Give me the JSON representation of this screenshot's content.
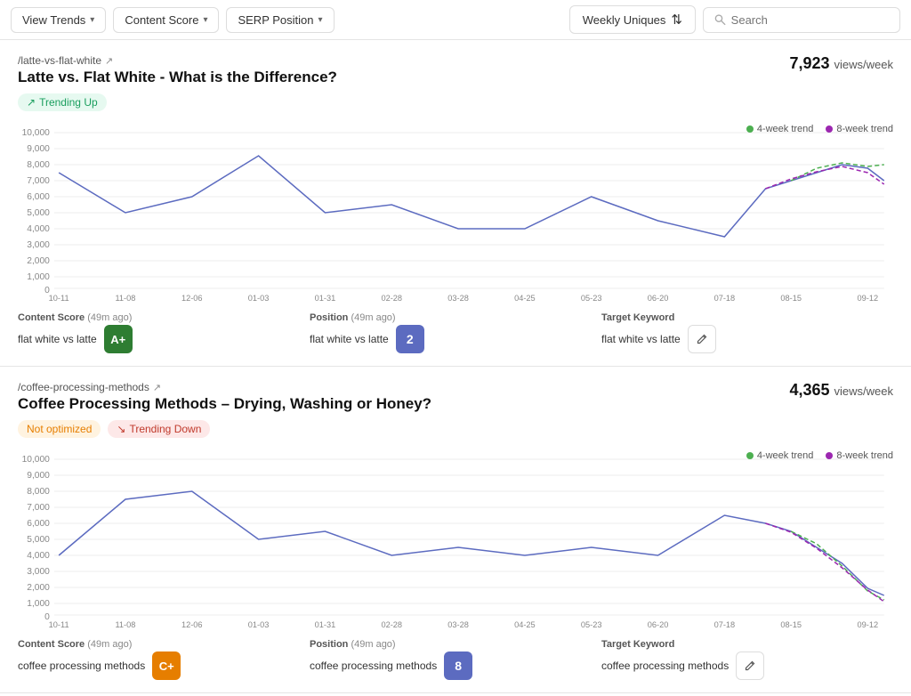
{
  "toolbar": {
    "view_trends_label": "View Trends",
    "content_score_label": "Content Score",
    "serp_position_label": "SERP Position",
    "weekly_uniques_label": "Weekly Uniques",
    "search_placeholder": "Search"
  },
  "cards": [
    {
      "url": "/latte-vs-flat-white",
      "title": "Latte vs. Flat White - What is the Difference?",
      "views": "7,923",
      "views_label": "views/week",
      "badge": "trending_up",
      "badge_label": "Trending Up",
      "legend_4week": "4-week trend",
      "legend_8week": "8-week trend",
      "chart_y_labels": [
        "10,000",
        "9,000",
        "8,000",
        "7,000",
        "6,000",
        "5,000",
        "4,000",
        "3,000",
        "2,000",
        "1,000",
        "0"
      ],
      "chart_x_labels": [
        "10-11",
        "11-08",
        "12-06",
        "01-03",
        "01-31",
        "02-28",
        "03-28",
        "04-25",
        "05-23",
        "06-20",
        "07-18",
        "08-15",
        "09-12"
      ],
      "footer": {
        "content_score_label": "Content Score",
        "content_score_time": "(49m ago)",
        "content_score_keyword": "flat white vs latte",
        "content_score_value": "A+",
        "position_label": "Position",
        "position_time": "(49m ago)",
        "position_keyword": "flat white vs latte",
        "position_value": "2",
        "target_keyword_label": "Target Keyword",
        "target_keyword_value": "flat white vs latte"
      }
    },
    {
      "url": "/coffee-processing-methods",
      "title": "Coffee Processing Methods – Drying, Washing or Honey?",
      "views": "4,365",
      "views_label": "views/week",
      "badge": "not_optimized_and_trending_down",
      "badge_not_optimized_label": "Not optimized",
      "badge_trending_down_label": "Trending Down",
      "legend_4week": "4-week trend",
      "legend_8week": "8-week trend",
      "chart_y_labels": [
        "10,000",
        "9,000",
        "8,000",
        "7,000",
        "6,000",
        "5,000",
        "4,000",
        "3,000",
        "2,000",
        "1,000",
        "0"
      ],
      "chart_x_labels": [
        "10-11",
        "11-08",
        "12-06",
        "01-03",
        "01-31",
        "02-28",
        "03-28",
        "04-25",
        "05-23",
        "06-20",
        "07-18",
        "08-15",
        "09-12"
      ],
      "footer": {
        "content_score_label": "Content Score",
        "content_score_time": "(49m ago)",
        "content_score_keyword": "coffee processing methods",
        "content_score_value": "C+",
        "position_label": "Position",
        "position_time": "(49m ago)",
        "position_keyword": "coffee processing methods",
        "position_value": "8",
        "target_keyword_label": "Target Keyword",
        "target_keyword_value": "coffee processing methods"
      }
    }
  ]
}
